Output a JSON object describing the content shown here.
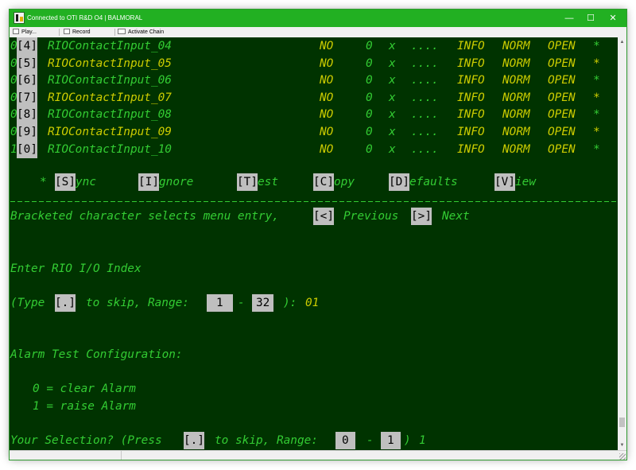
{
  "window": {
    "title": "Connected to OTI R&D O4 | BALMORAL",
    "icon": "terminal-app-icon",
    "controls": {
      "minimize": "—",
      "maximize": "☐",
      "close": "✕"
    }
  },
  "toolbar": {
    "play_label": "Play...",
    "record_label": "Record",
    "activate_chain_label": "Activate Chain"
  },
  "terminal": {
    "rows": [
      {
        "lead": "0",
        "idx": "[4]",
        "name": "RIOContactInput_04",
        "a": "NO",
        "b": "0",
        "c": "x",
        "d": "....",
        "sev": "INFO",
        "state": "NORM",
        "contact": "OPEN",
        "mark": "*",
        "name_color": "green"
      },
      {
        "lead": "0",
        "idx": "[5]",
        "name": "RIOContactInput_05",
        "a": "NO",
        "b": "0",
        "c": "x",
        "d": "....",
        "sev": "INFO",
        "state": "NORM",
        "contact": "OPEN",
        "mark": "*",
        "name_color": "yellow"
      },
      {
        "lead": "0",
        "idx": "[6]",
        "name": "RIOContactInput_06",
        "a": "NO",
        "b": "0",
        "c": "x",
        "d": "....",
        "sev": "INFO",
        "state": "NORM",
        "contact": "OPEN",
        "mark": "*",
        "name_color": "green"
      },
      {
        "lead": "0",
        "idx": "[7]",
        "name": "RIOContactInput_07",
        "a": "NO",
        "b": "0",
        "c": "x",
        "d": "....",
        "sev": "INFO",
        "state": "NORM",
        "contact": "OPEN",
        "mark": "*",
        "name_color": "yellow"
      },
      {
        "lead": "0",
        "idx": "[8]",
        "name": "RIOContactInput_08",
        "a": "NO",
        "b": "0",
        "c": "x",
        "d": "....",
        "sev": "INFO",
        "state": "NORM",
        "contact": "OPEN",
        "mark": "*",
        "name_color": "green"
      },
      {
        "lead": "0",
        "idx": "[9]",
        "name": "RIOContactInput_09",
        "a": "NO",
        "b": "0",
        "c": "x",
        "d": "....",
        "sev": "INFO",
        "state": "NORM",
        "contact": "OPEN",
        "mark": "*",
        "name_color": "yellow"
      },
      {
        "lead": "1",
        "idx": "[0]",
        "name": "RIOContactInput_10",
        "a": "NO",
        "b": "0",
        "c": "x",
        "d": "....",
        "sev": "INFO",
        "state": "NORM",
        "contact": "OPEN",
        "mark": "*",
        "name_color": "green"
      }
    ],
    "menu": {
      "star": "*",
      "sync_key": "[S]",
      "sync_rest": "ync",
      "ignore_key": "[I]",
      "ignore_rest": "gnore",
      "test_key": "[T]",
      "test_rest": "est",
      "copy_key": "[C]",
      "copy_rest": "opy",
      "defaults_key": "[D]",
      "defaults_rest": "efaults",
      "view_key": "[V]",
      "view_rest": "iew"
    },
    "help": {
      "text": "Bracketed character selects menu entry,",
      "prev_key": "[<]",
      "prev_label": "Previous",
      "next_key": "[>]",
      "next_label": "Next"
    },
    "prompt_index": {
      "label": "Enter RIO I/O Index",
      "type_prefix": "(Type",
      "skip_key": "[.]",
      "skip_text": "to skip, Range:",
      "range_min": "1",
      "dash": "-",
      "range_max": "32",
      "close": "):",
      "value": "01"
    },
    "alarm_config": {
      "label": "Alarm Test Configuration:",
      "option_0": "0 = clear Alarm",
      "option_1": "1 = raise Alarm"
    },
    "selection": {
      "prefix": "Your Selection? (Press",
      "skip_key": "[.]",
      "skip_text": "to skip, Range:",
      "range_min": "0",
      "dash": "-",
      "range_max": "1",
      "close": ")",
      "value": "1"
    }
  },
  "colors": {
    "terminal_bg": "#003300",
    "text_green": "#33cc33",
    "text_yellow": "#cccc00",
    "key_box": "#bfbfbf",
    "titlebar": "#22b022"
  }
}
